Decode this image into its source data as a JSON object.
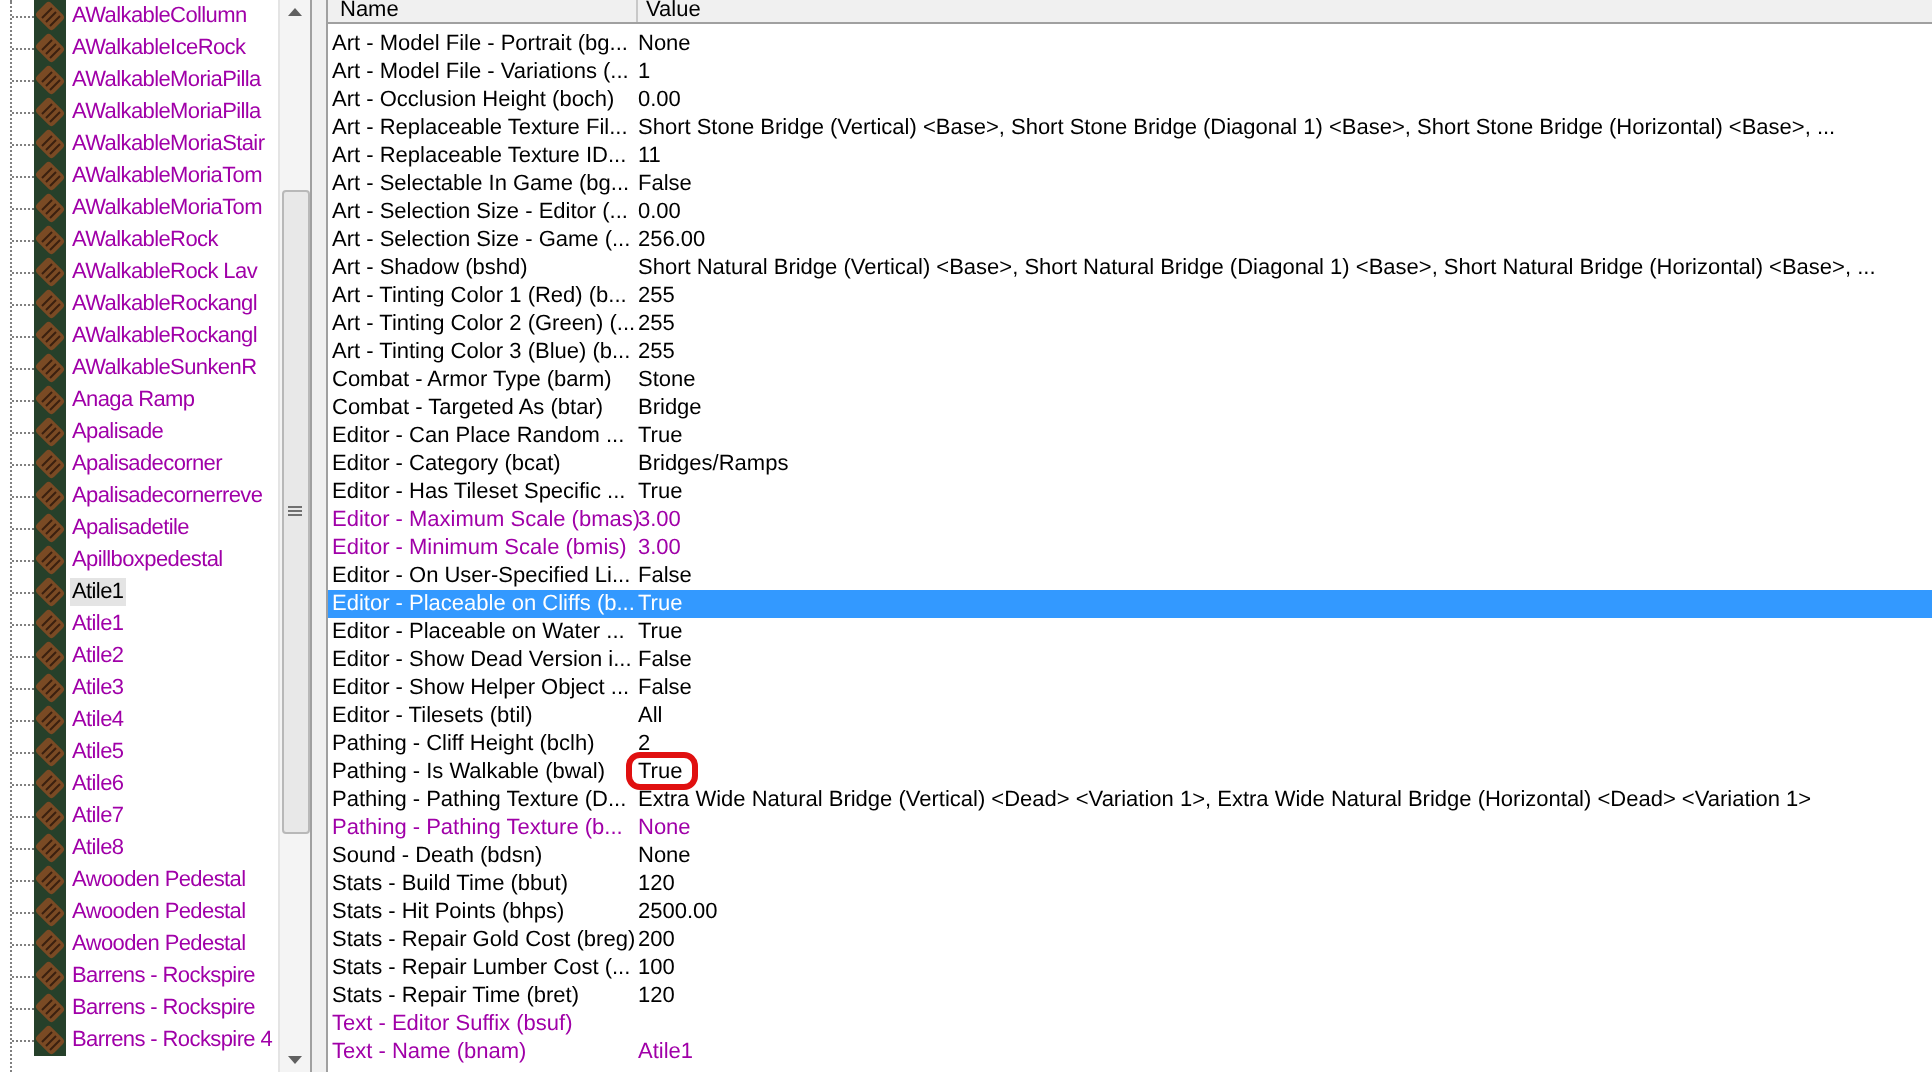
{
  "tree": {
    "items": [
      {
        "label": "AWalkableCollumn",
        "selected": false
      },
      {
        "label": "AWalkableIceRock",
        "selected": false
      },
      {
        "label": "AWalkableMoriaPilla",
        "selected": false
      },
      {
        "label": "AWalkableMoriaPilla",
        "selected": false
      },
      {
        "label": "AWalkableMoriaStair",
        "selected": false
      },
      {
        "label": "AWalkableMoriaTom",
        "selected": false
      },
      {
        "label": "AWalkableMoriaTom",
        "selected": false
      },
      {
        "label": "AWalkableRock",
        "selected": false
      },
      {
        "label": "AWalkableRock Lav",
        "selected": false
      },
      {
        "label": "AWalkableRockangl",
        "selected": false
      },
      {
        "label": "AWalkableRockangl",
        "selected": false
      },
      {
        "label": "AWalkableSunkenR",
        "selected": false
      },
      {
        "label": "Anaga Ramp",
        "selected": false
      },
      {
        "label": "Apalisade",
        "selected": false
      },
      {
        "label": "Apalisadecorner",
        "selected": false
      },
      {
        "label": "Apalisadecornerreve",
        "selected": false
      },
      {
        "label": "Apalisadetile",
        "selected": false
      },
      {
        "label": "Apillboxpedestal",
        "selected": false
      },
      {
        "label": "Atile1",
        "selected": true
      },
      {
        "label": "Atile1",
        "selected": false
      },
      {
        "label": "Atile2",
        "selected": false
      },
      {
        "label": "Atile3",
        "selected": false
      },
      {
        "label": "Atile4",
        "selected": false
      },
      {
        "label": "Atile5",
        "selected": false
      },
      {
        "label": "Atile6",
        "selected": false
      },
      {
        "label": "Atile7",
        "selected": false
      },
      {
        "label": "Atile8",
        "selected": false
      },
      {
        "label": "Awooden Pedestal",
        "selected": false
      },
      {
        "label": "Awooden Pedestal",
        "selected": false
      },
      {
        "label": "Awooden Pedestal",
        "selected": false
      },
      {
        "label": "Barrens - Rockspire",
        "selected": false
      },
      {
        "label": "Barrens - Rockspire",
        "selected": false
      },
      {
        "label": "Barrens - Rockspire 4",
        "selected": false
      }
    ]
  },
  "table": {
    "columns": [
      "Name",
      "Value"
    ],
    "rows": [
      {
        "name": "Art - Model File - Portrait (bg...",
        "value": "None",
        "modified": false,
        "selected": false
      },
      {
        "name": "Art - Model File - Variations (...",
        "value": "1",
        "modified": false,
        "selected": false
      },
      {
        "name": "Art - Occlusion Height (boch)",
        "value": "0.00",
        "modified": false,
        "selected": false
      },
      {
        "name": "Art - Replaceable Texture Fil...",
        "value": "Short Stone Bridge (Vertical) <Base>, Short Stone Bridge (Diagonal 1) <Base>, Short Stone Bridge (Horizontal) <Base>, ...",
        "modified": false,
        "selected": false
      },
      {
        "name": "Art - Replaceable Texture ID...",
        "value": "11",
        "modified": false,
        "selected": false
      },
      {
        "name": "Art - Selectable In Game (bg...",
        "value": "False",
        "modified": false,
        "selected": false
      },
      {
        "name": "Art - Selection Size - Editor (...",
        "value": "0.00",
        "modified": false,
        "selected": false
      },
      {
        "name": "Art - Selection Size - Game (...",
        "value": "256.00",
        "modified": false,
        "selected": false
      },
      {
        "name": "Art - Shadow (bshd)",
        "value": "Short Natural Bridge (Vertical) <Base>, Short Natural Bridge (Diagonal 1) <Base>, Short Natural Bridge (Horizontal) <Base>, ...",
        "modified": false,
        "selected": false
      },
      {
        "name": "Art - Tinting Color 1 (Red) (b...",
        "value": "255",
        "modified": false,
        "selected": false
      },
      {
        "name": "Art - Tinting Color 2 (Green) (...",
        "value": "255",
        "modified": false,
        "selected": false
      },
      {
        "name": "Art - Tinting Color 3 (Blue) (b...",
        "value": "255",
        "modified": false,
        "selected": false
      },
      {
        "name": "Combat - Armor Type (barm)",
        "value": "Stone",
        "modified": false,
        "selected": false
      },
      {
        "name": "Combat - Targeted As (btar)",
        "value": "Bridge",
        "modified": false,
        "selected": false
      },
      {
        "name": "Editor - Can Place Random ...",
        "value": "True",
        "modified": false,
        "selected": false
      },
      {
        "name": "Editor - Category (bcat)",
        "value": "Bridges/Ramps",
        "modified": false,
        "selected": false
      },
      {
        "name": "Editor - Has Tileset Specific ...",
        "value": "True",
        "modified": false,
        "selected": false
      },
      {
        "name": "Editor - Maximum Scale (bmas)",
        "value": "3.00",
        "modified": true,
        "selected": false
      },
      {
        "name": "Editor - Minimum Scale (bmis)",
        "value": "3.00",
        "modified": true,
        "selected": false
      },
      {
        "name": "Editor - On User-Specified Li...",
        "value": "False",
        "modified": false,
        "selected": false
      },
      {
        "name": "Editor - Placeable on Cliffs (b...",
        "value": "True",
        "modified": false,
        "selected": true
      },
      {
        "name": "Editor - Placeable on Water ...",
        "value": "True",
        "modified": false,
        "selected": false
      },
      {
        "name": "Editor - Show Dead Version i...",
        "value": "False",
        "modified": false,
        "selected": false
      },
      {
        "name": "Editor - Show Helper Object ...",
        "value": "False",
        "modified": false,
        "selected": false
      },
      {
        "name": "Editor - Tilesets (btil)",
        "value": "All",
        "modified": false,
        "selected": false
      },
      {
        "name": "Pathing - Cliff Height (bclh)",
        "value": "2",
        "modified": false,
        "selected": false
      },
      {
        "name": "Pathing - Is Walkable (bwal)",
        "value": "True",
        "modified": false,
        "selected": false,
        "annotated": true
      },
      {
        "name": "Pathing - Pathing Texture (D...",
        "value": "Extra Wide Natural Bridge (Vertical) <Dead> <Variation 1>, Extra Wide Natural Bridge (Horizontal) <Dead> <Variation 1>",
        "modified": false,
        "selected": false
      },
      {
        "name": "Pathing - Pathing Texture (b...",
        "value": "None",
        "modified": true,
        "selected": false
      },
      {
        "name": "Sound - Death (bdsn)",
        "value": "None",
        "modified": false,
        "selected": false
      },
      {
        "name": "Stats - Build Time (bbut)",
        "value": "120",
        "modified": false,
        "selected": false
      },
      {
        "name": "Stats - Hit Points (bhps)",
        "value": "2500.00",
        "modified": false,
        "selected": false
      },
      {
        "name": "Stats - Repair Gold Cost (breg)",
        "value": "200",
        "modified": false,
        "selected": false
      },
      {
        "name": "Stats - Repair Lumber Cost (...",
        "value": "100",
        "modified": false,
        "selected": false
      },
      {
        "name": "Stats - Repair Time (bret)",
        "value": "120",
        "modified": false,
        "selected": false
      },
      {
        "name": "Text - Editor Suffix (bsuf)",
        "modified": true,
        "selected": false
      },
      {
        "name": "Text - Name (bnam)",
        "value": "Atile1",
        "modified": true,
        "selected": false
      }
    ]
  }
}
